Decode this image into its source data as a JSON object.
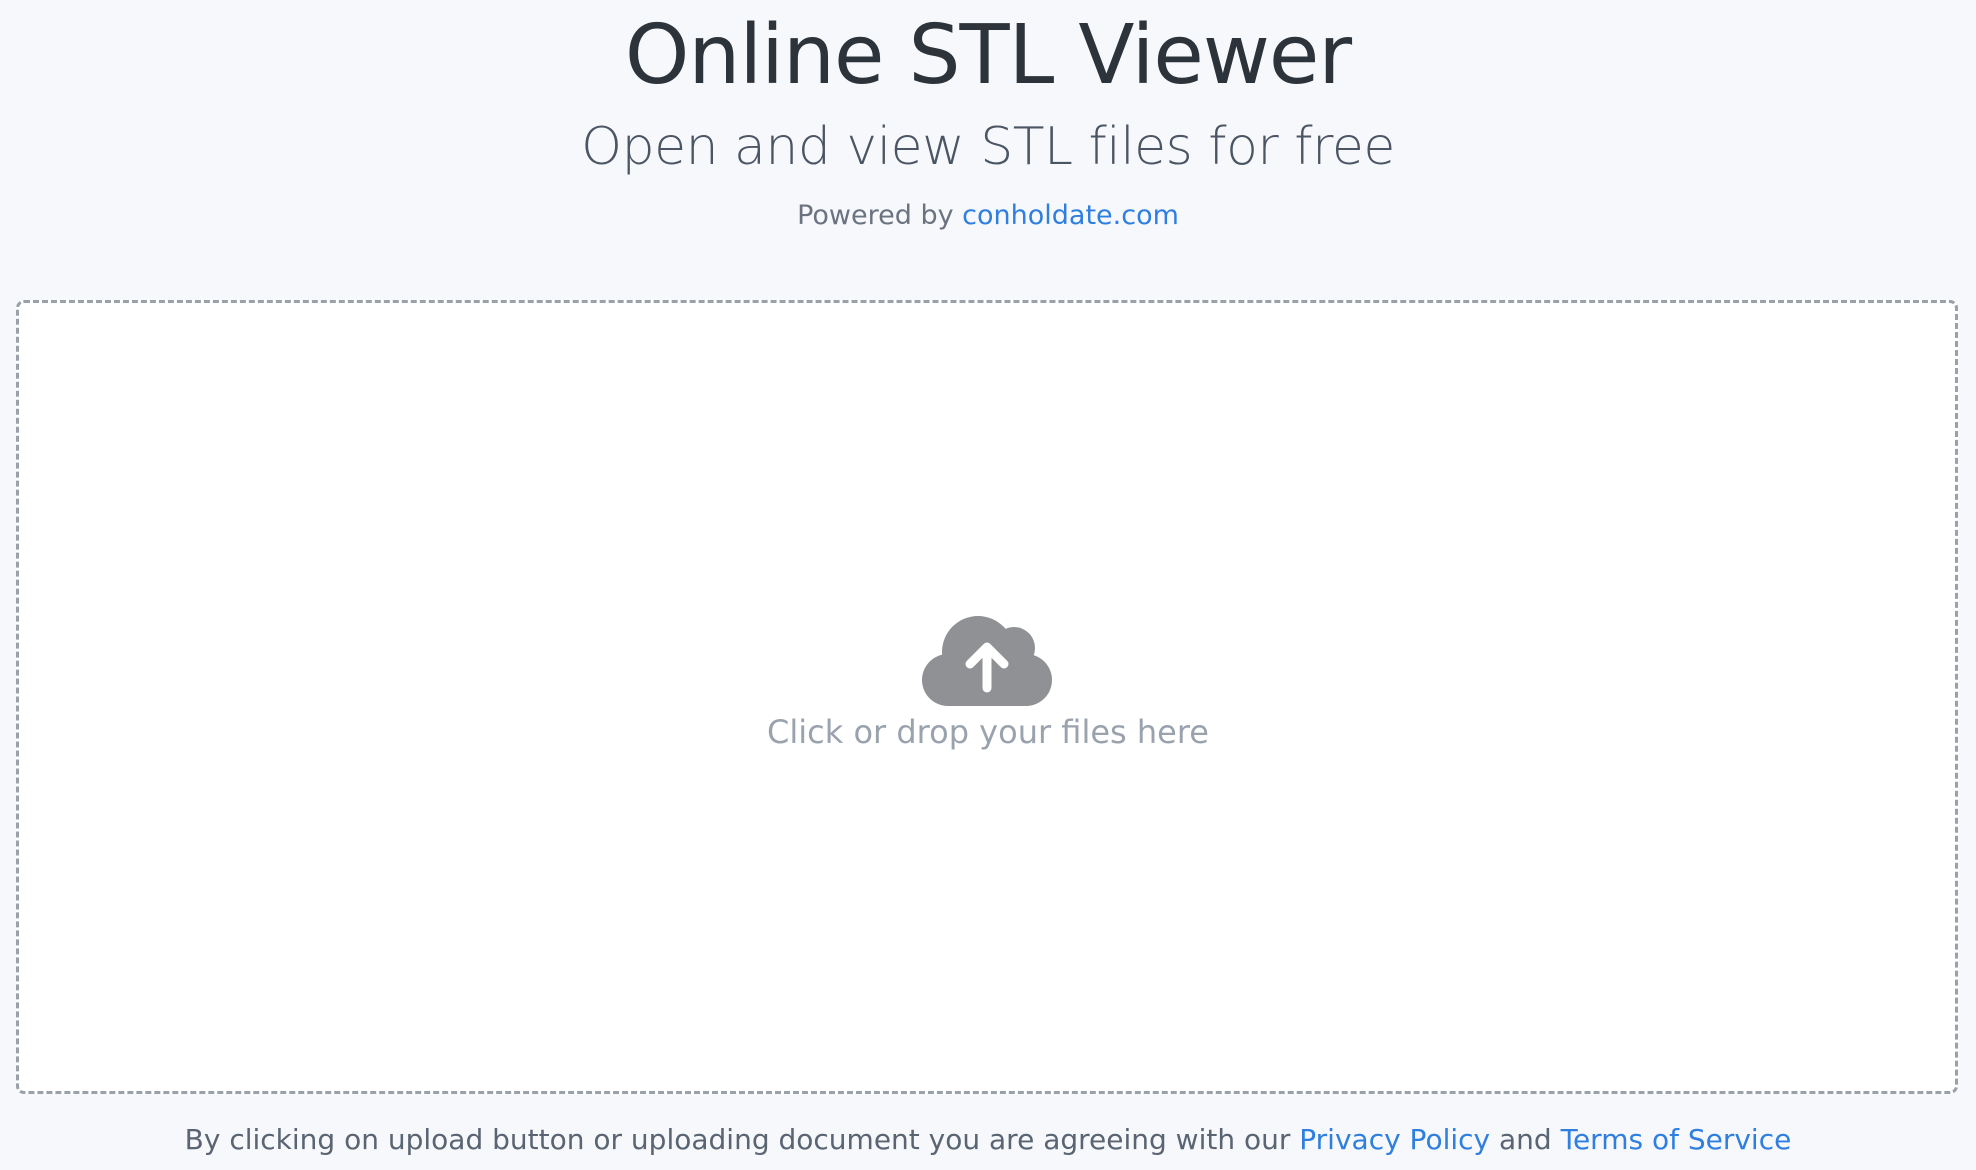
{
  "header": {
    "title": "Online STL Viewer",
    "subtitle": "Open and view STL files for free",
    "powered_prefix": "Powered by",
    "powered_link": "conholdate.com"
  },
  "dropzone": {
    "icon": "cloud-upload-icon",
    "text": "Click or drop your files here"
  },
  "footer": {
    "text_prefix": "By clicking on upload button or uploading document you are agreeing with our",
    "privacy_link": "Privacy Policy",
    "and": "and",
    "terms_link": "Terms of Service"
  },
  "colors": {
    "background": "#f6f8fb",
    "link": "#2f7fe0",
    "icon": "#8f9194",
    "dropzone_border": "#9aa1a9"
  }
}
